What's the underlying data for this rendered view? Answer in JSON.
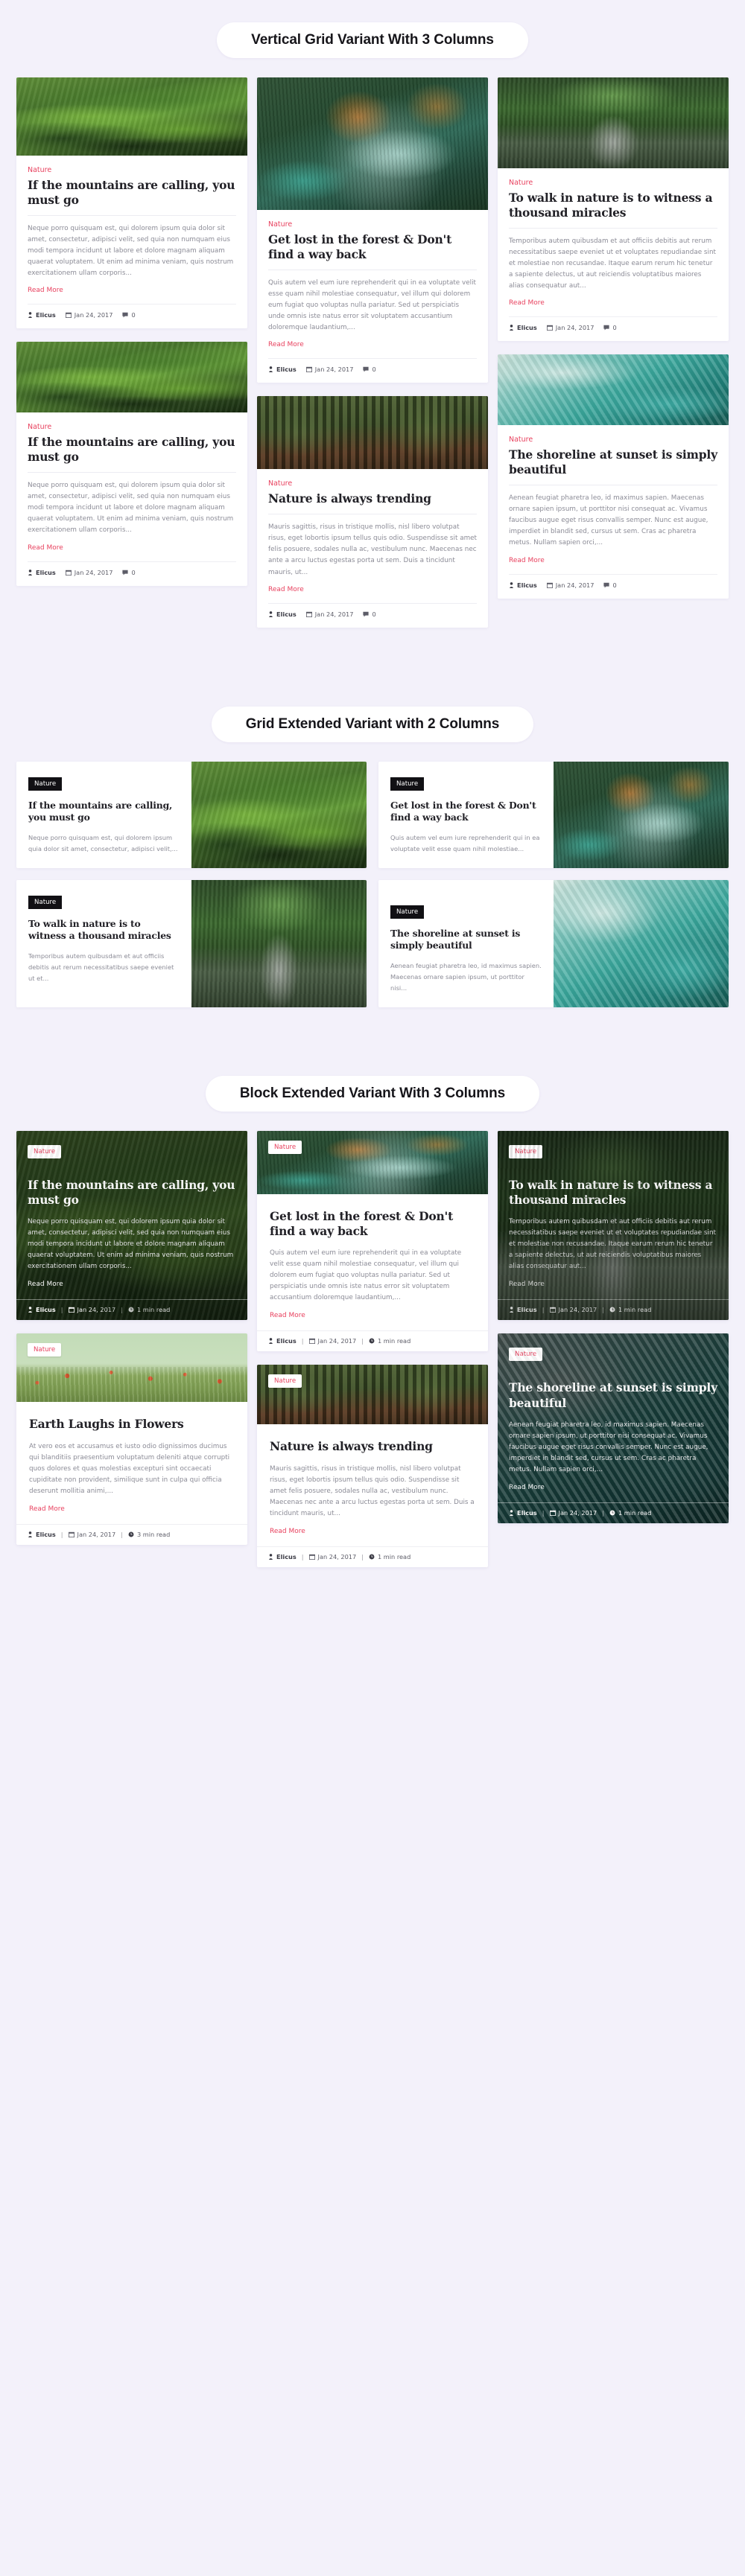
{
  "colors": {
    "page_bg": "#f3f1fa",
    "accent": "#e8415e",
    "heading": "#222127",
    "muted": "#8b8b96",
    "badge_dark": "#111014"
  },
  "sections": [
    {
      "id": "vertical-grid",
      "heading": "Vertical Grid Variant With 3 Columns"
    },
    {
      "id": "grid-extended",
      "heading": "Grid Extended Variant with 2 Columns"
    },
    {
      "id": "block-extended",
      "heading": "Block Extended Variant With 3 Columns"
    }
  ],
  "labels": {
    "read_more": "Read More",
    "category": "Nature",
    "author": "Elicus",
    "date": "Jan 24, 2017",
    "comments": "0",
    "separator": "|"
  },
  "icons": {
    "user": "user-icon",
    "calendar": "calendar-icon",
    "comment": "comment-icon",
    "clock": "clock-icon"
  },
  "vertical_grid": {
    "col1": [
      {
        "category": "Nature",
        "title": "If the mountains are calling, you must go",
        "excerpt": "Neque porro quisquam est, qui dolorem ipsum quia dolor sit amet, consectetur, adipisci velit, sed quia non numquam eius modi tempora incidunt ut labore et dolore magnam aliquam quaerat voluptatem. Ut enim ad minima veniam, quis nostrum exercitationem ullam corporis...",
        "read_more": "Read More",
        "author": "Elicus",
        "date": "Jan 24, 2017",
        "comments": "0",
        "image": "green-hills"
      },
      {
        "category": "Nature",
        "title": "If the mountains are calling, you must go",
        "excerpt": "Neque porro quisquam est, qui dolorem ipsum quia dolor sit amet, consectetur, adipisci velit, sed quia non numquam eius modi tempora incidunt ut labore et dolore magnam aliquam quaerat voluptatem. Ut enim ad minima veniam, quis nostrum exercitationem ullam corporis...",
        "read_more": "Read More",
        "author": "Elicus",
        "date": "Jan 24, 2017",
        "comments": "0",
        "image": "green-hills"
      }
    ],
    "col2": [
      {
        "category": "Nature",
        "title": "Get lost in the forest & Don't find a way back",
        "excerpt": "Quis autem vel eum iure reprehenderit qui in ea voluptate velit esse quam nihil molestiae consequatur, vel illum qui dolorem eum fugiat quo voluptas nulla pariatur. Sed ut perspiciatis unde omnis iste natus error sit voluptatem accusantium doloremque laudantium,...",
        "read_more": "Read More",
        "author": "Elicus",
        "date": "Jan 24, 2017",
        "comments": "0",
        "image": "forest-lake"
      },
      {
        "category": "Nature",
        "title": "Nature is always trending",
        "excerpt": "Mauris sagittis, risus in tristique mollis, nisl libero volutpat risus, eget lobortis ipsum tellus quis odio. Suspendisse sit amet felis posuere, sodales nulla ac, vestibulum nunc. Maecenas nec ante a arcu luctus egestas porta ut sem. Duis a tincidunt mauris, ut...",
        "read_more": "Read More",
        "author": "Elicus",
        "date": "Jan 24, 2017",
        "comments": "0",
        "image": "woods"
      }
    ],
    "col3": [
      {
        "category": "Nature",
        "title": "To walk in nature is to witness a thousand miracles",
        "excerpt": "Temporibus autem quibusdam et aut officiis debitis aut rerum necessitatibus saepe eveniet ut et voluptates repudiandae sint et molestiae non recusandae. Itaque earum rerum hic tenetur a sapiente delectus, ut aut reiciendis voluptatibus maiores alias consequatur aut...",
        "read_more": "Read More",
        "author": "Elicus",
        "date": "Jan 24, 2017",
        "comments": "0",
        "image": "bridge"
      },
      {
        "category": "Nature",
        "title": "The shoreline at sunset is simply beautiful",
        "excerpt": "Aenean feugiat pharetra leo, id maximus sapien. Maecenas ornare sapien ipsum, ut porttitor nisi consequat ac. Vivamus faucibus augue eget risus convallis semper. Nunc est augue, imperdiet in blandit sed, cursus ut sem. Cras ac pharetra metus. Nullam sapien orci,...",
        "read_more": "Read More",
        "author": "Elicus",
        "date": "Jan 24, 2017",
        "comments": "0",
        "image": "shoreline"
      }
    ]
  },
  "grid_extended": [
    {
      "badge": "Nature",
      "title": "If the mountains are calling, you must go",
      "excerpt": "Neque porro quisquam est, qui dolorem ipsum quia dolor sit amet, consectetur, adipisci velit,...",
      "image": "green-hills"
    },
    {
      "badge": "Nature",
      "title": "Get lost in the forest & Don't find a way back",
      "excerpt": "Quis autem vel eum iure reprehenderit qui in ea voluptate velit esse quam nihil molestiae...",
      "image": "forest-lake"
    },
    {
      "badge": "Nature",
      "title": "To walk in nature is to witness a thousand miracles",
      "excerpt": "Temporibus autem quibusdam et aut officiis debitis aut rerum necessitatibus saepe eveniet ut et...",
      "image": "bridge"
    },
    {
      "badge": "Nature",
      "title": "The shoreline at sunset is simply beautiful",
      "excerpt": "Aenean feugiat pharetra leo, id maximus sapien. Maecenas ornare sapien ipsum, ut porttitor nisi...",
      "image": "shoreline"
    }
  ],
  "block_extended": {
    "col1": [
      {
        "badge": "Nature",
        "title": "If the mountains are calling, you must go",
        "excerpt": "Neque porro quisquam est, qui dolorem ipsum quia dolor sit amet, consectetur, adipisci velit, sed quia non numquam eius modi tempora incidunt ut labore et dolore magnam aliquam quaerat voluptatem. Ut enim ad minima veniam, quis nostrum exercitationem ullam corporis...",
        "read_more": "Read More",
        "author": "Elicus",
        "date": "Jan 24, 2017",
        "read_time": "1 min read",
        "image": "green-hills",
        "style": "dark"
      },
      {
        "badge": "Nature",
        "title": "Earth Laughs in Flowers",
        "excerpt": "At vero eos et accusamus et iusto odio dignissimos ducimus qui blanditiis praesentium voluptatum deleniti atque corrupti quos dolores et quas molestias excepturi sint occaecati cupiditate non provident, similique sunt in culpa qui officia deserunt mollitia animi,...",
        "read_more": "Read More",
        "author": "Elicus",
        "date": "Jan 24, 2017",
        "read_time": "3 min read",
        "image": "poppy-field",
        "style": "light"
      }
    ],
    "col2": [
      {
        "badge": "Nature",
        "title": "Get lost in the forest & Don't find a way back",
        "excerpt": "Quis autem vel eum iure reprehenderit qui in ea voluptate velit esse quam nihil molestiae consequatur, vel illum qui dolorem eum fugiat quo voluptas nulla pariatur. Sed ut perspiciatis unde omnis iste natus error sit voluptatem accusantium doloremque laudantium,...",
        "read_more": "Read More",
        "author": "Elicus",
        "date": "Jan 24, 2017",
        "read_time": "1 min read",
        "image": "forest-lake",
        "style": "light"
      },
      {
        "badge": "Nature",
        "title": "Nature is always trending",
        "excerpt": "Mauris sagittis, risus in tristique mollis, nisl libero volutpat risus, eget lobortis ipsum tellus quis odio. Suspendisse sit amet felis posuere, sodales nulla ac, vestibulum nunc. Maecenas nec ante a arcu luctus egestas porta ut sem. Duis a tincidunt mauris, ut...",
        "read_more": "Read More",
        "author": "Elicus",
        "date": "Jan 24, 2017",
        "read_time": "1 min read",
        "image": "woods",
        "style": "light"
      }
    ],
    "col3": [
      {
        "badge": "Nature",
        "title": "To walk in nature is to witness a thousand miracles",
        "excerpt": "Temporibus autem quibusdam et aut officiis debitis aut rerum necessitatibus saepe eveniet ut et voluptates repudiandae sint et molestiae non recusandae. Itaque earum rerum hic tenetur a sapiente delectus, ut aut reiciendis voluptatibus maiores alias consequatur aut...",
        "read_more": "Read More",
        "author": "Elicus",
        "date": "Jan 24, 2017",
        "read_time": "1 min read",
        "image": "bridge",
        "style": "dark"
      },
      {
        "badge": "Nature",
        "title": "The shoreline at sunset is simply beautiful",
        "excerpt": "Aenean feugiat pharetra leo, id maximus sapien. Maecenas ornare sapien ipsum, ut porttitor nisi consequat ac. Vivamus faucibus augue eget risus convallis semper. Nunc est augue, imperdiet in blandit sed, cursus ut sem. Cras ac pharetra metus. Nullam sapien orci,...",
        "read_more": "Read More",
        "author": "Elicus",
        "date": "Jan 24, 2017",
        "read_time": "1 min read",
        "image": "shoreline",
        "style": "dark"
      }
    ]
  }
}
